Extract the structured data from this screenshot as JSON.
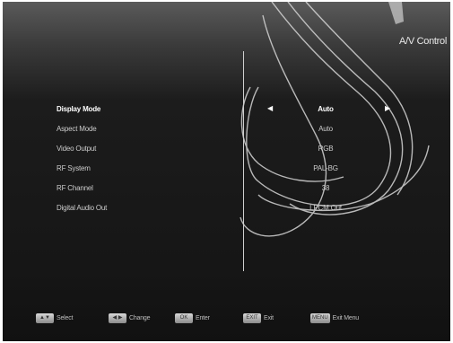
{
  "header": {
    "title": "A/V Control"
  },
  "menu": {
    "items": [
      {
        "label": "Display Mode",
        "value": "Auto"
      },
      {
        "label": "Aspect Mode",
        "value": "Auto"
      },
      {
        "label": "Video Output",
        "value": "RGB"
      },
      {
        "label": "RF System",
        "value": "PAL-BG"
      },
      {
        "label": "RF Channel",
        "value": "38"
      },
      {
        "label": "Digital Audio Out",
        "value": "LPCM Out"
      }
    ],
    "left_arrow": "◀",
    "right_arrow": "▶"
  },
  "footer": {
    "hints": [
      {
        "key": "▲▼",
        "label": "Select"
      },
      {
        "key": "◀ ▶",
        "label": "Change"
      },
      {
        "key": "OK",
        "label": "Enter"
      },
      {
        "key": "EXIT",
        "label": "Exit"
      },
      {
        "key": "MENU",
        "label": "Exit Menu"
      }
    ]
  },
  "colors": {
    "background": "#1a1a1a",
    "header_gradient_top": "#5a5a5a",
    "text_normal": "#cccccc",
    "text_active": "#ffffff",
    "swirl": "#d8d8d8"
  }
}
